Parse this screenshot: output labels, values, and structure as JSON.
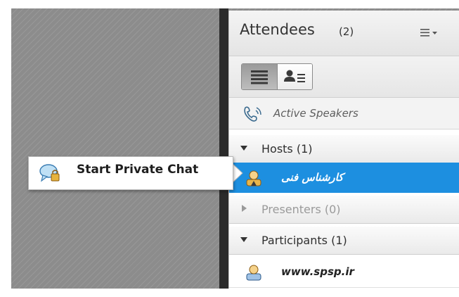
{
  "pod": {
    "title": "Attendees",
    "count": "(2)",
    "menu_icon": "list-menu-icon"
  },
  "toolbar": {
    "list_view_icon": "list-view-icon",
    "detail_view_icon": "user-detail-view-icon"
  },
  "active_speakers": {
    "label": "Active Speakers",
    "icon": "phone-speaking-icon"
  },
  "sections": {
    "hosts": "Hosts (1)",
    "presenters": "Presenters (0)",
    "participants": "Participants (1)"
  },
  "users": {
    "host": {
      "name": "کارشناس فنی",
      "icon": "host-user-icon",
      "selected": true
    },
    "participant": {
      "name": "www.spsp.ir",
      "icon": "participant-user-icon"
    }
  },
  "context_menu": {
    "label": "Start Private Chat",
    "icon": "private-chat-icon"
  },
  "colors": {
    "selection": "#1d8fe0",
    "stage_background": "#8c8c8c",
    "divider": "#2b2b2b"
  }
}
